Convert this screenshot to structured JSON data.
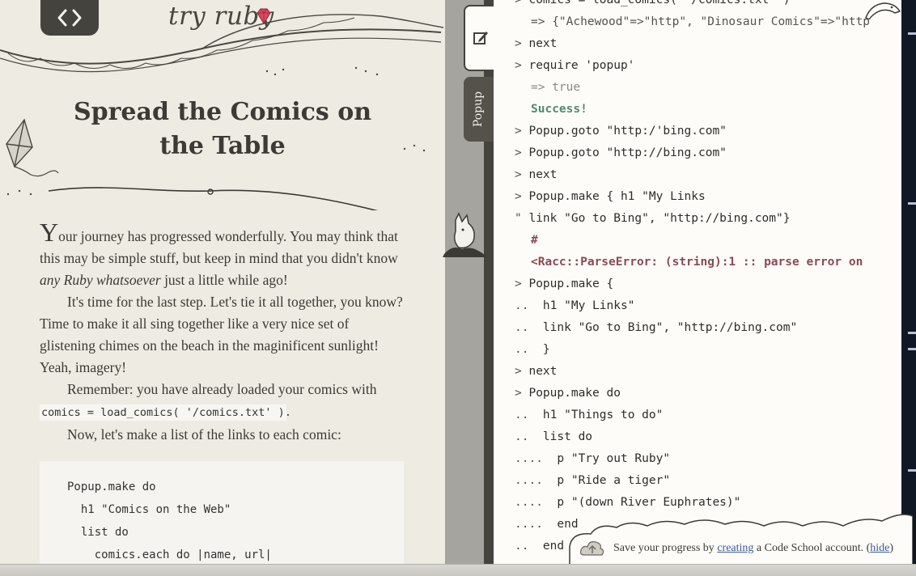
{
  "brand": {
    "name": "try ruby"
  },
  "lesson": {
    "title": "Spread the Comics on the Table",
    "p1_dropcap": "Y",
    "p1_text_a": "our journey has progressed wonderfully. You may think that this may be simple stuff, but keep in mind that you didn't know ",
    "p1_em": "any Ruby whatsoever",
    "p1_text_b": " just a little while ago!",
    "p2": "It's time for the last step. Let's tie it all together, you know? Time to make it all sing together like a very nice set of glistening chimes on the beach in the maginificent sunlight! Yeah, imagery!",
    "p3_text": "Remember: you have already loaded your comics with ",
    "p3_code": "comics = load_comics( '/comics.txt' )",
    "p3_end": ".",
    "p4": "Now, let's make a list of the links to each comic:",
    "code_lines": [
      "Popup.make do",
      "  h1 \"Comics on the Web\"",
      "  list do",
      "    comics.each do |name, url|"
    ]
  },
  "tabs": {
    "editor": "editor",
    "popup": "Popup"
  },
  "console": {
    "lines": [
      {
        "prompt": ">",
        "text": "comics = load_comics( '/comics.txt' )",
        "kind": "input"
      },
      {
        "prompt": "",
        "text": "=> {\"Achewood\"=>\"http\", \"Dinosaur Comics\"=>\"http",
        "kind": "result-dark"
      },
      {
        "prompt": ">",
        "text": "next",
        "kind": "input"
      },
      {
        "prompt": ">",
        "text": "require 'popup'",
        "kind": "input"
      },
      {
        "prompt": "",
        "text": "=> true",
        "kind": "result"
      },
      {
        "prompt": "",
        "text": "Success!",
        "kind": "success"
      },
      {
        "prompt": ">",
        "text": "Popup.goto \"http:/'bing.com\"",
        "kind": "input"
      },
      {
        "prompt": ">",
        "text": "Popup.goto \"http://bing.com\"",
        "kind": "input"
      },
      {
        "prompt": ">",
        "text": "next",
        "kind": "input"
      },
      {
        "prompt": ">",
        "text": "Popup.make { h1 \"My Links",
        "kind": "input"
      },
      {
        "prompt": "\"",
        "text": "link \"Go to Bing\", \"http://bing.com\"}",
        "kind": "input"
      },
      {
        "prompt": "",
        "text": "#",
        "kind": "error"
      },
      {
        "prompt": "",
        "text": "<Racc::ParseError: (string):1 :: parse error on",
        "kind": "error"
      },
      {
        "prompt": ">",
        "text": "Popup.make {",
        "kind": "input"
      },
      {
        "prompt": "..",
        "text": " h1 \"My Links\"",
        "kind": "input"
      },
      {
        "prompt": "..",
        "text": " link \"Go to Bing\", \"http://bing.com\"",
        "kind": "input"
      },
      {
        "prompt": "..",
        "text": " }",
        "kind": "input"
      },
      {
        "prompt": ">",
        "text": "next",
        "kind": "input"
      },
      {
        "prompt": ">",
        "text": "Popup.make do",
        "kind": "input"
      },
      {
        "prompt": "..",
        "text": " h1 \"Things to do\"",
        "kind": "input"
      },
      {
        "prompt": "..",
        "text": " list do",
        "kind": "input"
      },
      {
        "prompt": "....",
        "text": " p \"Try out Ruby\"",
        "kind": "input"
      },
      {
        "prompt": "....",
        "text": " p \"Ride a tiger\"",
        "kind": "input"
      },
      {
        "prompt": "....",
        "text": " p \"(down River Euphrates)\"",
        "kind": "input"
      },
      {
        "prompt": "....",
        "text": " end",
        "kind": "input"
      },
      {
        "prompt": "..",
        "text": " end",
        "kind": "input"
      }
    ]
  },
  "save_banner": {
    "text_a": "Save your progress by ",
    "link_create": "creating",
    "text_b": " a Code School account. (",
    "link_hide": "hide",
    "text_c": ")"
  },
  "colors": {
    "paper": "#eeebe3",
    "ink": "#3c3a35",
    "dark": "#45433d",
    "success": "#4e8b6f",
    "error": "#8b4a52",
    "link": "#3a5a9a",
    "gem": "#e0475b"
  }
}
